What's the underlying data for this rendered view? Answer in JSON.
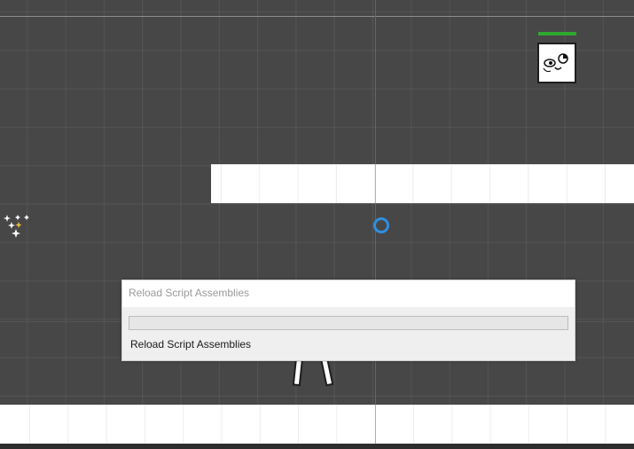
{
  "dialog": {
    "title": "Reload Script Assemblies",
    "status": "Reload Script Assemblies",
    "progress": 0
  },
  "scene": {
    "background_color": "#474747",
    "platform_color": "#ffffff",
    "enemy_health_color": "#2ea82e",
    "pivot_color": "#2f8fe0",
    "enemy_health": 1.0
  }
}
